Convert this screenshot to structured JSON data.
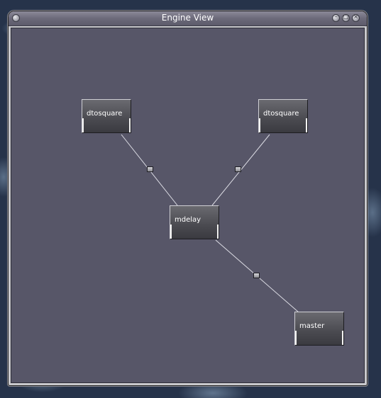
{
  "window": {
    "title": "Engine View",
    "buttons": {
      "menu": "window-menu-icon",
      "minimize": "minimize-icon",
      "maximize": "maximize-icon",
      "close": "close-icon"
    },
    "button_glyphs": {
      "minimize": "–",
      "maximize": "□",
      "close": "×"
    }
  },
  "graph": {
    "nodes": [
      {
        "id": "dtosquare-1",
        "label": "dtosquare"
      },
      {
        "id": "dtosquare-2",
        "label": "dtosquare"
      },
      {
        "id": "mdelay",
        "label": "mdelay"
      },
      {
        "id": "master",
        "label": "master"
      }
    ],
    "connections": [
      {
        "from": "dtosquare-1",
        "to": "mdelay"
      },
      {
        "from": "dtosquare-2",
        "to": "mdelay"
      },
      {
        "from": "mdelay",
        "to": "master"
      }
    ]
  },
  "colors": {
    "canvas": "#575668",
    "edge": "#dcdce4",
    "node_text": "#ffffff"
  }
}
